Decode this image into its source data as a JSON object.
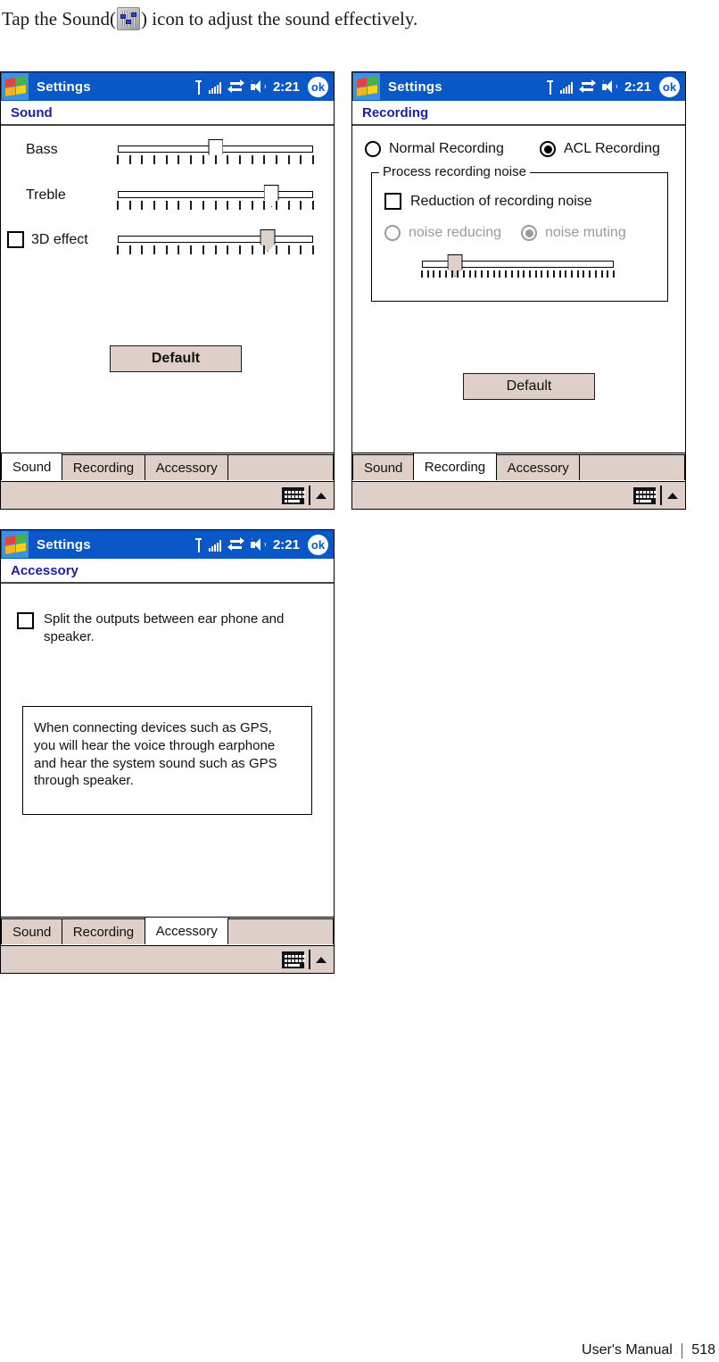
{
  "intro": {
    "before": "Tap the Sound(",
    "icon": "sound-mixer-icon",
    "after": ") icon to adjust the sound effectively."
  },
  "titlebar": {
    "app_title": "Settings",
    "clock": "2:21",
    "ok_label": "ok",
    "icons": [
      "signal-strength-icon",
      "connectivity-icon",
      "volume-icon",
      "ok-button"
    ]
  },
  "tabs": {
    "sound": "Sound",
    "recording": "Recording",
    "accessory": "Accessory"
  },
  "sip": {
    "keyboard_icon": "soft-keyboard-icon",
    "arrow_icon": "sip-chevron-up-icon"
  },
  "panels": {
    "sound": {
      "heading": "Sound",
      "active_tab": "Sound",
      "sliders": [
        {
          "label": "Bass",
          "value_percent": 50,
          "ticks": 17,
          "disabled": false
        },
        {
          "label": "Treble",
          "value_percent": 79,
          "ticks": 17,
          "disabled": false
        },
        {
          "label": "3D effect",
          "value_percent": 77,
          "ticks": 17,
          "disabled": true
        }
      ],
      "checkbox_3d": {
        "label": "3D effect",
        "checked": false
      },
      "default_button": "Default"
    },
    "recording": {
      "heading": "Recording",
      "active_tab": "Recording",
      "radios_mode": [
        {
          "label": "Normal Recording",
          "selected": false,
          "disabled": false
        },
        {
          "label": "ACL Recording",
          "selected": true,
          "disabled": false
        }
      ],
      "group_title": "Process recording noise",
      "checkbox_reduction": {
        "label": "Reduction of recording noise",
        "checked": false
      },
      "radios_noise": [
        {
          "label": "noise reducing",
          "selected": false,
          "disabled": true
        },
        {
          "label": "noise muting",
          "selected": true,
          "disabled": true
        }
      ],
      "noise_slider": {
        "value_percent": 17,
        "ticks": 33,
        "disabled": true
      },
      "default_button": "Default"
    },
    "accessory": {
      "heading": "Accessory",
      "active_tab": "Accessory",
      "checkbox_split": {
        "label": "Split the outputs between ear phone and speaker.",
        "checked": false
      },
      "info_lines": [
        "When connecting devices such as GPS,",
        "you will hear the voice through earphone",
        "and hear the system sound such as GPS",
        "through speaker."
      ]
    }
  },
  "footer": {
    "manual_label": "User's Manual",
    "page_number": "518"
  }
}
